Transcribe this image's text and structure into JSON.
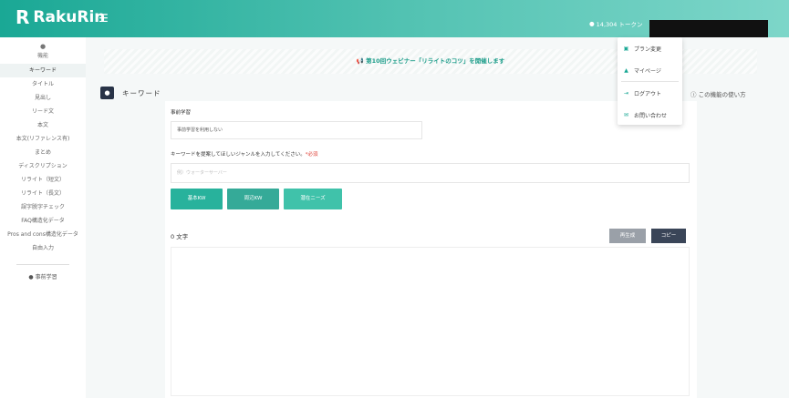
{
  "brand": {
    "logo_mark": "R",
    "name": "RakuRin"
  },
  "header": {
    "token_text": "14,304 トークン"
  },
  "sidebar": {
    "top_label": "機能",
    "items": [
      {
        "label": "キーワード",
        "active": true
      },
      {
        "label": "タイトル"
      },
      {
        "label": "見出し"
      },
      {
        "label": "リード文"
      },
      {
        "label": "本文"
      },
      {
        "label": "本文(リファレンス有)"
      },
      {
        "label": "まとめ"
      },
      {
        "label": "ディスクリプション"
      },
      {
        "label": "リライト（短文）"
      },
      {
        "label": "リライト（長文）"
      },
      {
        "label": "誤字脱字チェック"
      },
      {
        "label": "FAQ構造化データ"
      },
      {
        "label": "Pros and cons構造化データ"
      },
      {
        "label": "自由入力"
      }
    ],
    "study_label": "事前学習"
  },
  "banner": {
    "text": "第10回ウェビナー「リライトのコツ」を開催します"
  },
  "page": {
    "title": "キーワード",
    "howto": "この機能の使い方"
  },
  "form": {
    "pretrain_label": "事前学習",
    "pretrain_value": "事前学習を利用しない",
    "genre_label": "キーワードを提案してほしいジャンルを入力してください。",
    "required": "*必須",
    "genre_placeholder": "例）ウォーターサーバー",
    "buttons": [
      "基本KW",
      "周辺KW",
      "潜在ニーズ"
    ]
  },
  "output": {
    "char_count": "0 文字",
    "regenerate": "再生成",
    "copy": "コピー"
  },
  "dropdown": {
    "items": [
      {
        "icon": "book-icon",
        "label": "プラン変更"
      },
      {
        "icon": "user-icon",
        "label": "マイページ"
      },
      {
        "icon": "logout-icon",
        "label": "ログアウト"
      },
      {
        "icon": "mail-icon",
        "label": "お問い合わせ"
      }
    ]
  },
  "colors": {
    "brand_teal": "#1aa895",
    "dark_navy": "#283347",
    "required_red": "#e0443a"
  }
}
